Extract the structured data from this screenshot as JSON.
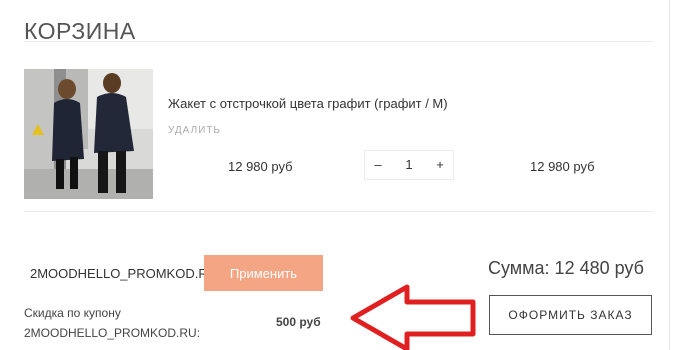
{
  "page": {
    "title": "КОРЗИНА"
  },
  "cart_item": {
    "name": "Жакет с отстрочкой цвета графит (графит / M)",
    "remove_label": "УДАЛИТЬ",
    "unit_price": "12 980 руб",
    "quantity": "1",
    "minus_label": "–",
    "plus_label": "+",
    "line_total": "12 980 руб"
  },
  "coupon": {
    "code": "2MOODHELLO_PROMKOD.RU",
    "apply_label": "Применить",
    "discount_label": "Скидка по купону",
    "discount_code": "2MOODHELLO_PROMKOD.RU:",
    "discount_value": "500 руб"
  },
  "summary": {
    "total_text": "Сумма: 12 480 руб",
    "order_button_label": "ОФОРМИТЬ ЗАКАЗ"
  },
  "colors": {
    "apply_button": "#f4a584",
    "annotation_arrow": "#e02020"
  }
}
